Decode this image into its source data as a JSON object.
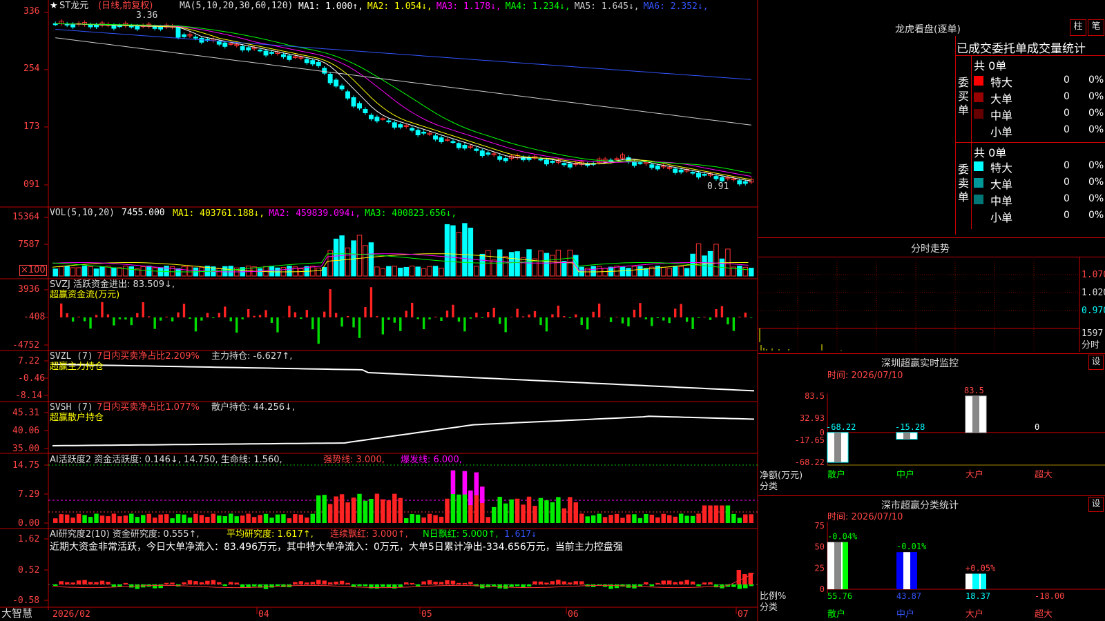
{
  "stock": {
    "name": "ST龙元",
    "period": "(日线,前复权)",
    "low_price": "0.91",
    "high_price": "3.36"
  },
  "main_legend": {
    "prefix": "MA(5,10,20,30,60,120)",
    "items": [
      {
        "label": "MA1: 1.000",
        "arrow": "↑",
        "color": "#ffffff"
      },
      {
        "label": "MA2: 1.054",
        "arrow": "↓",
        "color": "#ffff00"
      },
      {
        "label": "MA3: 1.178",
        "arrow": "↓",
        "color": "#ff00ff"
      },
      {
        "label": "MA4: 1.234",
        "arrow": "↓",
        "color": "#00ff00"
      },
      {
        "label": "MA5: 1.645",
        "arrow": "↓",
        "color": "#cccccc"
      },
      {
        "label": "MA6: 2.352",
        "arrow": "↓",
        "color": "#3355ff"
      }
    ]
  },
  "price_axis": [
    "336",
    "254",
    "173",
    "091"
  ],
  "vol_panel": {
    "prefix": "VOL(5,10,20)",
    "value": "7455.000",
    "items": [
      {
        "label": "MA1: 403761.188",
        "arrow": "↓",
        "color": "#ffff00"
      },
      {
        "label": "MA2: 459839.094",
        "arrow": "↓",
        "color": "#ff00ff"
      },
      {
        "label": "MA3: 400823.656",
        "arrow": "↓",
        "color": "#00ff00"
      }
    ],
    "axis": [
      "15364",
      "7587",
      "×100"
    ]
  },
  "svzj_panel": {
    "line1": "SVZJ  活跃资金进出: 83.509↓,",
    "line2": "超赢资金流(万元)",
    "axis": [
      "3936",
      "-408",
      "-4752"
    ]
  },
  "svzl_panel": {
    "prefix": "SVZL (7)",
    "mid": "7日内买卖净占比2.209%",
    "tail": "主力持仓: -6.627↑,",
    "line2": "超赢主力持仓",
    "axis": [
      "7.22",
      "-0.46",
      "-8.14"
    ]
  },
  "svsh_panel": {
    "prefix": "SVSH (7)",
    "mid": "7日内买卖净占比1.077%",
    "tail": "散户持仓: 44.256↓,",
    "line2": "超赢散户持仓",
    "axis": [
      "45.31",
      "40.06",
      "35.00"
    ]
  },
  "ai_active": {
    "prefix": "AI活跃度2 资金活跃度: 0.146↓, 14.750, 生命线: 1.560,",
    "strong": "强势线: 3.000,",
    "burst": "爆发线: 6.000,",
    "axis": [
      "14.75",
      "7.29",
      "0.00"
    ]
  },
  "ai_research": {
    "prefix": "AI研究度2(10) 资金研究度: 0.555↑,",
    "avg": "平均研究度: 1.617↑,",
    "cont": "连续飘红: 3.000↑,",
    "nday": "N日飘红: 5.000↑,",
    "last": "1.617↓",
    "comment": "近期大资金非常活跃，今日大单净流入：83.496万元，其中特大单净流入：0万元，大单5日累计净出-334.656万元，当前主力控盘强",
    "axis": [
      "1.62",
      "0.52",
      "-0.58"
    ]
  },
  "date_axis": {
    "brand": "大智慧",
    "labels": [
      "2026/02",
      "04",
      "05",
      "06",
      "07"
    ]
  },
  "dragon": {
    "title": "龙虎看盘(逐单)",
    "btn1": "柱",
    "btn2": "笔",
    "subtitle": "已成交委托单成交量统计",
    "buy_label": "委买单",
    "sell_label": "委卖单",
    "buy_total": "共 0单",
    "sell_total": "共 0单",
    "buy_rows": [
      {
        "name": "特大",
        "v": "0",
        "p": "0%",
        "color": "#ff0000"
      },
      {
        "name": "大单",
        "v": "0",
        "p": "0%",
        "color": "#990000"
      },
      {
        "name": "中单",
        "v": "0",
        "p": "0%",
        "color": "#660000"
      },
      {
        "name": "小单",
        "v": "0",
        "p": "0%",
        "color": ""
      }
    ],
    "sell_rows": [
      {
        "name": "特大",
        "v": "0",
        "p": "0%",
        "color": "#00ffff"
      },
      {
        "name": "大单",
        "v": "0",
        "p": "0%",
        "color": "#009999"
      },
      {
        "name": "中单",
        "v": "0",
        "p": "0%",
        "color": "#007777"
      },
      {
        "name": "小单",
        "v": "0",
        "p": "0%",
        "color": ""
      }
    ]
  },
  "intraday": {
    "title": "分时走势",
    "axis": [
      "1.070",
      "1.020",
      "0.970"
    ],
    "vol_label": "1597",
    "vol_unit": "分时"
  },
  "sz_monitor": {
    "title": "深圳超赢实时监控",
    "btn": "设",
    "time": "时间: 2026/07/10",
    "axis": [
      "83.5",
      "32.93",
      "0",
      "-17.65",
      "-68.22"
    ],
    "side_label": "净额(万元)",
    "cat_label": "分类",
    "categories": [
      "散户",
      "中户",
      "大户",
      "超大"
    ],
    "values": [
      -68.22,
      -15.28,
      83.5,
      0
    ],
    "value_labels": [
      "-68.22",
      "-15.28",
      "83.5",
      "0"
    ]
  },
  "sz_stats": {
    "title": "深市超赢分类统计",
    "btn": "设",
    "time": "时间: 2026/07/10",
    "axis": [
      "75",
      "50",
      "25",
      "0"
    ],
    "side_label": "比例%",
    "cat_label": "分类",
    "categories": [
      "散户",
      "中户",
      "大户",
      "超大"
    ],
    "values": [
      55.76,
      43.87,
      18.37,
      -18.0
    ],
    "value_labels": [
      "55.76",
      "43.87",
      "18.37",
      "-18.00"
    ],
    "change_labels": [
      "-0.04%",
      "-0.01%",
      "+0.05%",
      ""
    ]
  },
  "chart_data": {
    "type": "bar",
    "title": "深圳超赢实时监控",
    "categories": [
      "散户",
      "中户",
      "大户",
      "超大"
    ],
    "values": [
      -68.22,
      -15.28,
      83.5,
      0
    ],
    "ylim": [
      -68.22,
      83.5
    ]
  }
}
